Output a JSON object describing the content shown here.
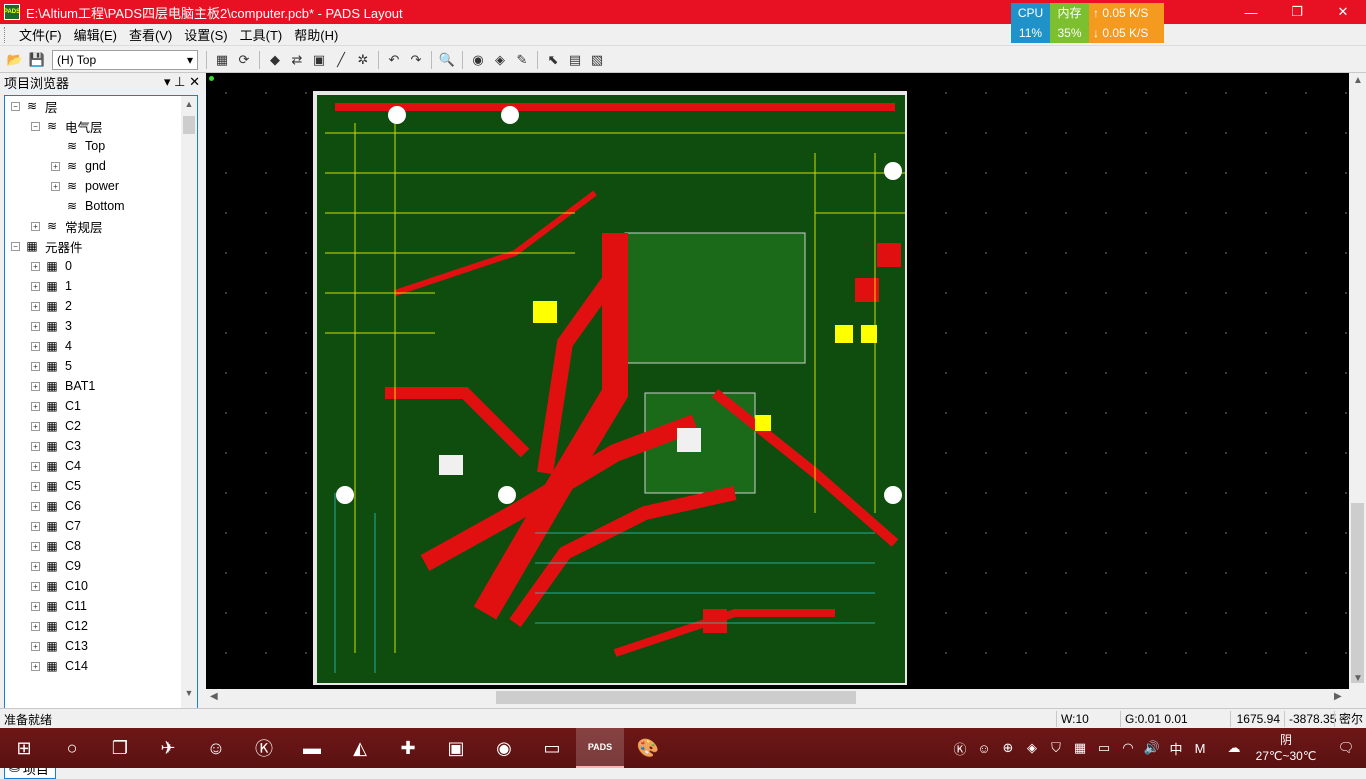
{
  "window": {
    "title": "E:\\Altium工程\\PADS四层电脑主板2\\computer.pcb* - PADS Layout",
    "app_icon_text": "PADS",
    "minimize": "—",
    "maximize": "❐",
    "close": "✕"
  },
  "perf": {
    "cpu_label": "CPU",
    "cpu_value": "11%",
    "mem_label": "内存",
    "mem_value": "35%",
    "up": "↑ 0.05 K/S",
    "down": "↓ 0.05 K/S"
  },
  "menu": {
    "items": [
      "文件(F)",
      "编辑(E)",
      "查看(V)",
      "设置(S)",
      "工具(T)",
      "帮助(H)"
    ]
  },
  "toolbar": {
    "layer_value": "(H) Top"
  },
  "browser": {
    "title": "项目浏览器",
    "pin": "▾ ⊥ ✕",
    "tab_label": "项目",
    "tree": [
      {
        "label": "层",
        "level": 0,
        "exp": "−",
        "icon": "layers-icon"
      },
      {
        "label": "电气层",
        "level": 1,
        "exp": "−",
        "icon": "layers-icon"
      },
      {
        "label": "Top",
        "level": 2,
        "exp": "",
        "icon": "layers-icon"
      },
      {
        "label": "gnd",
        "level": 2,
        "exp": "+",
        "icon": "layers-icon"
      },
      {
        "label": "power",
        "level": 2,
        "exp": "+",
        "icon": "layers-icon"
      },
      {
        "label": "Bottom",
        "level": 2,
        "exp": "",
        "icon": "layers-icon"
      },
      {
        "label": "常规层",
        "level": 1,
        "exp": "+",
        "icon": "layers-icon"
      },
      {
        "label": "元器件",
        "level": 0,
        "exp": "−",
        "icon": "component-icon"
      },
      {
        "label": "0",
        "level": 1,
        "exp": "+",
        "icon": "component-icon"
      },
      {
        "label": "1",
        "level": 1,
        "exp": "+",
        "icon": "component-icon"
      },
      {
        "label": "2",
        "level": 1,
        "exp": "+",
        "icon": "component-icon"
      },
      {
        "label": "3",
        "level": 1,
        "exp": "+",
        "icon": "component-icon"
      },
      {
        "label": "4",
        "level": 1,
        "exp": "+",
        "icon": "component-icon"
      },
      {
        "label": "5",
        "level": 1,
        "exp": "+",
        "icon": "component-icon"
      },
      {
        "label": "BAT1",
        "level": 1,
        "exp": "+",
        "icon": "component-icon"
      },
      {
        "label": "C1",
        "level": 1,
        "exp": "+",
        "icon": "component-icon"
      },
      {
        "label": "C2",
        "level": 1,
        "exp": "+",
        "icon": "component-icon"
      },
      {
        "label": "C3",
        "level": 1,
        "exp": "+",
        "icon": "component-icon"
      },
      {
        "label": "C4",
        "level": 1,
        "exp": "+",
        "icon": "component-icon"
      },
      {
        "label": "C5",
        "level": 1,
        "exp": "+",
        "icon": "component-icon"
      },
      {
        "label": "C6",
        "level": 1,
        "exp": "+",
        "icon": "component-icon"
      },
      {
        "label": "C7",
        "level": 1,
        "exp": "+",
        "icon": "component-icon"
      },
      {
        "label": "C8",
        "level": 1,
        "exp": "+",
        "icon": "component-icon"
      },
      {
        "label": "C9",
        "level": 1,
        "exp": "+",
        "icon": "component-icon"
      },
      {
        "label": "C10",
        "level": 1,
        "exp": "+",
        "icon": "component-icon"
      },
      {
        "label": "C11",
        "level": 1,
        "exp": "+",
        "icon": "component-icon"
      },
      {
        "label": "C12",
        "level": 1,
        "exp": "+",
        "icon": "component-icon"
      },
      {
        "label": "C13",
        "level": 1,
        "exp": "+",
        "icon": "component-icon"
      },
      {
        "label": "C14",
        "level": 1,
        "exp": "+",
        "icon": "component-icon"
      }
    ]
  },
  "status": {
    "ready": "准备就绪",
    "width": "W:10",
    "grid": "G:0.01 0.01",
    "x": "1675.94",
    "y": "-3878.35",
    "units": "密尔"
  },
  "taskbar": {
    "weather": "阴",
    "temp": "27℃~30℃",
    "ime": "中",
    "ime2": "M",
    "pads_label": "PADS"
  },
  "colors": {
    "title_bg": "#e81123",
    "board_green": "#0e4d0e",
    "trace_red": "#e01010",
    "pad_yellow": "#ffff00"
  }
}
